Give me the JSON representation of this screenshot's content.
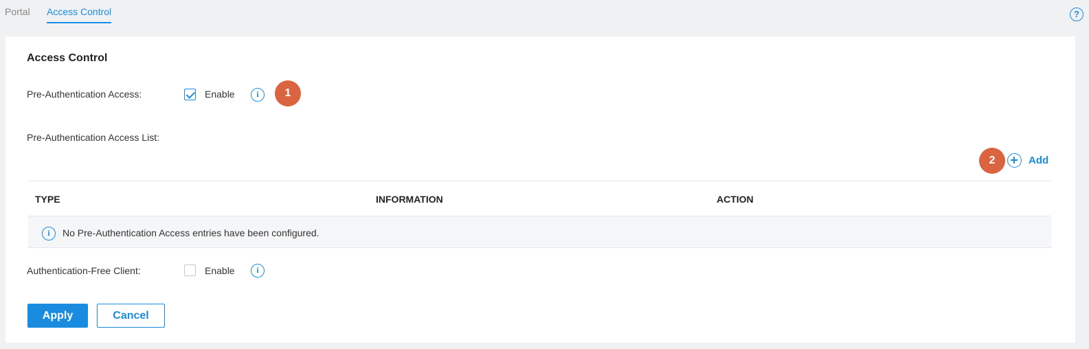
{
  "tabs": [
    {
      "label": "Portal",
      "active": false
    },
    {
      "label": "Access Control",
      "active": true
    }
  ],
  "help_icon": {
    "glyph": "?",
    "name": "help-icon"
  },
  "section": {
    "title": "Access Control"
  },
  "pre_auth": {
    "label": "Pre-Authentication Access:",
    "enabled": true,
    "enable_label": "Enable",
    "info_icon": "info-icon"
  },
  "badges": [
    "1",
    "2"
  ],
  "pre_auth_list": {
    "label": "Pre-Authentication Access List:",
    "add_label": "Add",
    "columns": [
      "TYPE",
      "INFORMATION",
      "ACTION"
    ],
    "empty_message": "No Pre-Authentication Access entries have been configured."
  },
  "auth_free": {
    "label": "Authentication-Free Client:",
    "enabled": false,
    "enable_label": "Enable",
    "info_icon": "info-icon"
  },
  "buttons": {
    "apply": "Apply",
    "cancel": "Cancel"
  },
  "colors": {
    "accent": "#1a8cdf",
    "badge": "#d9643f"
  }
}
